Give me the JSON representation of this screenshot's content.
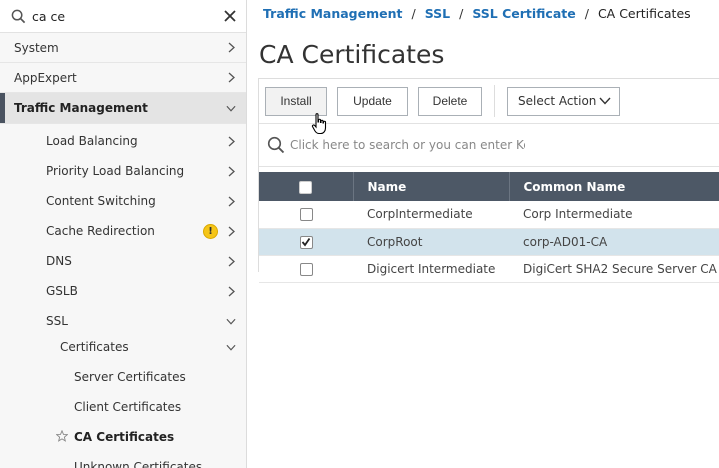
{
  "sidebar": {
    "search": {
      "value": "ca ce",
      "search_icon": "search-icon",
      "clear_icon": "close-icon"
    },
    "items": [
      {
        "label": "System",
        "level": 0,
        "expanded": false
      },
      {
        "label": "AppExpert",
        "level": 0,
        "expanded": false
      },
      {
        "label": "Traffic Management",
        "level": 0,
        "expanded": true,
        "selected": true
      },
      {
        "label": "Load Balancing",
        "level": 1,
        "expanded": false
      },
      {
        "label": "Priority Load Balancing",
        "level": 1,
        "expanded": false
      },
      {
        "label": "Content Switching",
        "level": 1,
        "expanded": false
      },
      {
        "label": "Cache Redirection",
        "level": 1,
        "expanded": false,
        "warning": "!"
      },
      {
        "label": "DNS",
        "level": 1,
        "expanded": false
      },
      {
        "label": "GSLB",
        "level": 1,
        "expanded": false
      },
      {
        "label": "SSL",
        "level": 1,
        "expanded": true
      },
      {
        "label": "Certificates",
        "level": 2,
        "expanded": true
      },
      {
        "label": "Server Certificates",
        "level": 3
      },
      {
        "label": "Client Certificates",
        "level": 3
      },
      {
        "label": "CA Certificates",
        "level": 3,
        "active": true,
        "icon": "star-icon"
      },
      {
        "label": "Unknown Certificates",
        "level": 3
      }
    ]
  },
  "breadcrumb": {
    "links": [
      "Traffic Management",
      "SSL",
      "SSL Certificate"
    ],
    "separator": "/",
    "current": "CA Certificates"
  },
  "page": {
    "title": "CA Certificates"
  },
  "toolbar": {
    "install_label": "Install",
    "update_label": "Update",
    "delete_label": "Delete",
    "select_action_label": "Select Action"
  },
  "table_search": {
    "placeholder": "Click here to search or you can enter Key : Va"
  },
  "table": {
    "columns": [
      "Name",
      "Common Name"
    ],
    "rows": [
      {
        "name": "CorpIntermediate",
        "common_name": "Corp Intermediate",
        "checked": false
      },
      {
        "name": "CorpRoot",
        "common_name": "corp-AD01-CA",
        "checked": true
      },
      {
        "name": "Digicert Intermediate",
        "common_name": "DigiCert SHA2 Secure Server CA",
        "checked": false
      }
    ]
  },
  "colors": {
    "header_bg": "#4d5866",
    "selected_row": "#d2e3ec",
    "link": "#1f6fb4",
    "warning": "#f5c518"
  }
}
